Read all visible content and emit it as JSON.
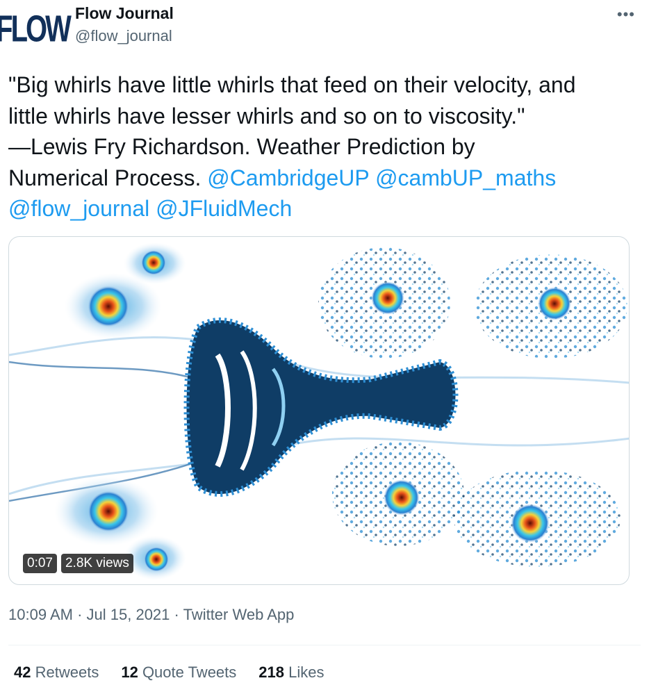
{
  "author": {
    "avatar_text": "FLOW",
    "name": "Flow Journal",
    "handle": "@flow_journal"
  },
  "more_label": "•••",
  "tweet": {
    "line1": "\"Big whirls have little whirls that feed on their velocity, and",
    "line2": "little whirls have lesser whirls and so on to viscosity.\"",
    "line3": "—Lewis Fry Richardson. Weather Prediction by",
    "line4_text": "Numerical Process.",
    "mentions": [
      "@CambridgeUP",
      "@cambUP_maths",
      "@flow_journal",
      "@JFluidMech"
    ]
  },
  "video": {
    "time": "0:07",
    "views": "2.8K views"
  },
  "meta": {
    "time": "10:09 AM",
    "date": "Jul 15, 2021",
    "source": "Twitter Web App"
  },
  "stats": [
    {
      "count": "42",
      "label": "Retweets"
    },
    {
      "count": "12",
      "label": "Quote Tweets"
    },
    {
      "count": "218",
      "label": "Likes"
    }
  ],
  "colors": {
    "link": "#1d9bf0",
    "vortex_dark": "#0f3d66",
    "vortex_mid": "#3aa6e0",
    "vortex_core": "#e8531a"
  }
}
